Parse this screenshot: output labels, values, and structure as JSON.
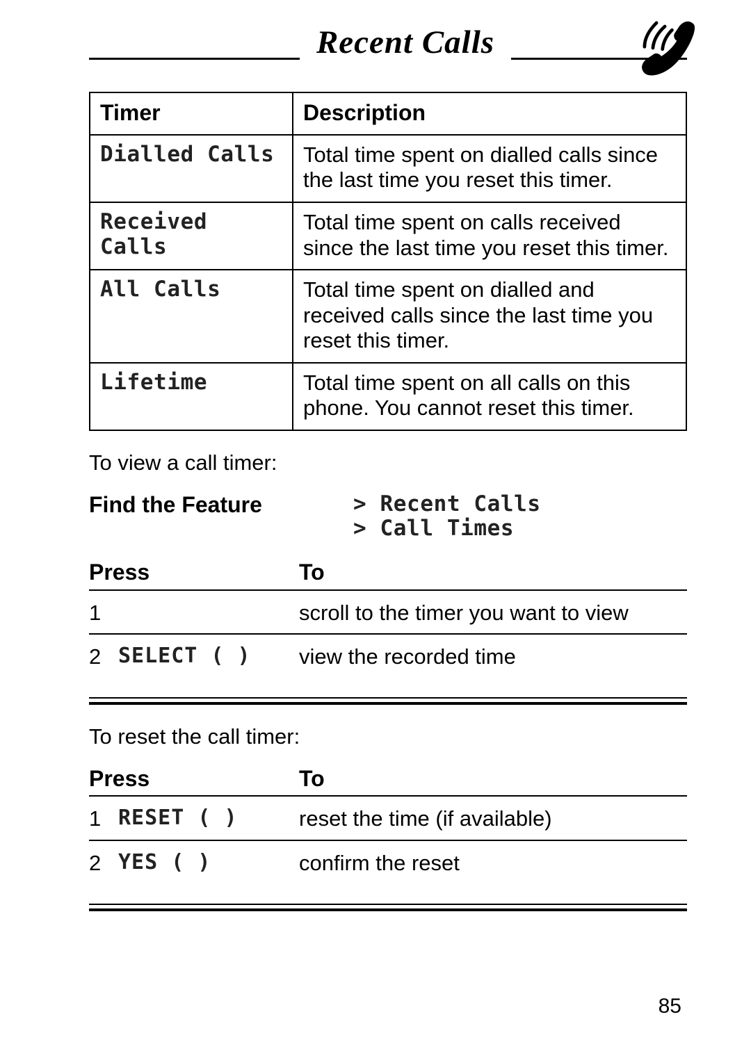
{
  "header": {
    "title": "Recent Calls"
  },
  "timer_table": {
    "headers": {
      "timer": "Timer",
      "description": "Description"
    },
    "rows": [
      {
        "name": "Dialled Calls",
        "desc": "Total time spent on dialled calls since the last time you reset this timer."
      },
      {
        "name": "Received Calls",
        "desc": "Total time spent on calls received since the last time you reset this timer."
      },
      {
        "name": "All Calls",
        "desc": "Total time spent on dialled and received calls since the last time you reset this timer."
      },
      {
        "name": "Lifetime",
        "desc": "Total time spent on all calls on this phone. You cannot reset this timer."
      }
    ]
  },
  "intro_view": "To view a call timer:",
  "find_feature": {
    "label": "Find the Feature",
    "paths": [
      "> Recent Calls",
      "> Call Times"
    ]
  },
  "steps_view": {
    "headers": {
      "press": "Press",
      "to": "To"
    },
    "rows": [
      {
        "num": "1",
        "press": "",
        "to": "scroll to the timer you want to view"
      },
      {
        "num": "2",
        "press": "SELECT (       )",
        "to": "view the recorded time"
      }
    ]
  },
  "intro_reset": "To reset the call timer:",
  "steps_reset": {
    "headers": {
      "press": "Press",
      "to": "To"
    },
    "rows": [
      {
        "num": "1",
        "press": "RESET (       )",
        "to": "reset the time (if available)"
      },
      {
        "num": "2",
        "press": "YES (       )",
        "to": "confirm the reset"
      }
    ]
  },
  "page_number": "85"
}
